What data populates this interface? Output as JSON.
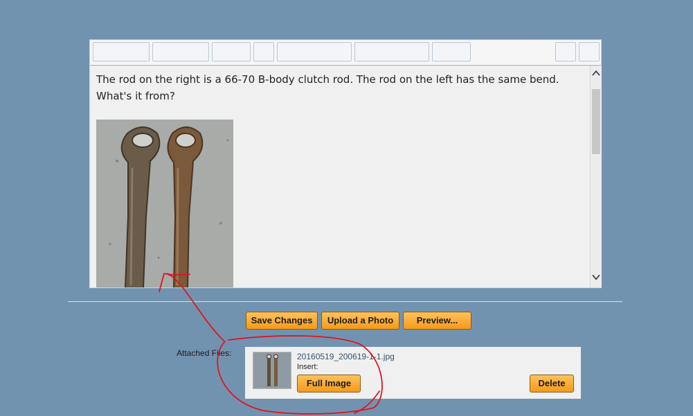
{
  "editor": {
    "text_line1": "The rod on the right is a 66-70 B-body clutch rod. The rod on the left has the same bend.",
    "text_line2": "What's it from?"
  },
  "buttons": {
    "save_changes": "Save Changes",
    "upload_photo": "Upload a Photo",
    "preview": "Preview..."
  },
  "attachments": {
    "label": "Attached Files:",
    "file_name": "20160519_200619-1-1.jpg",
    "insert_label": "Insert:",
    "full_image": "Full Image",
    "delete": "Delete"
  },
  "colors": {
    "background": "#7293b0",
    "button_orange": "#f7a933",
    "annotation_red": "#e0141e"
  },
  "icons": {
    "scroll_up": "chevron-up-icon",
    "scroll_down": "chevron-down-icon"
  }
}
